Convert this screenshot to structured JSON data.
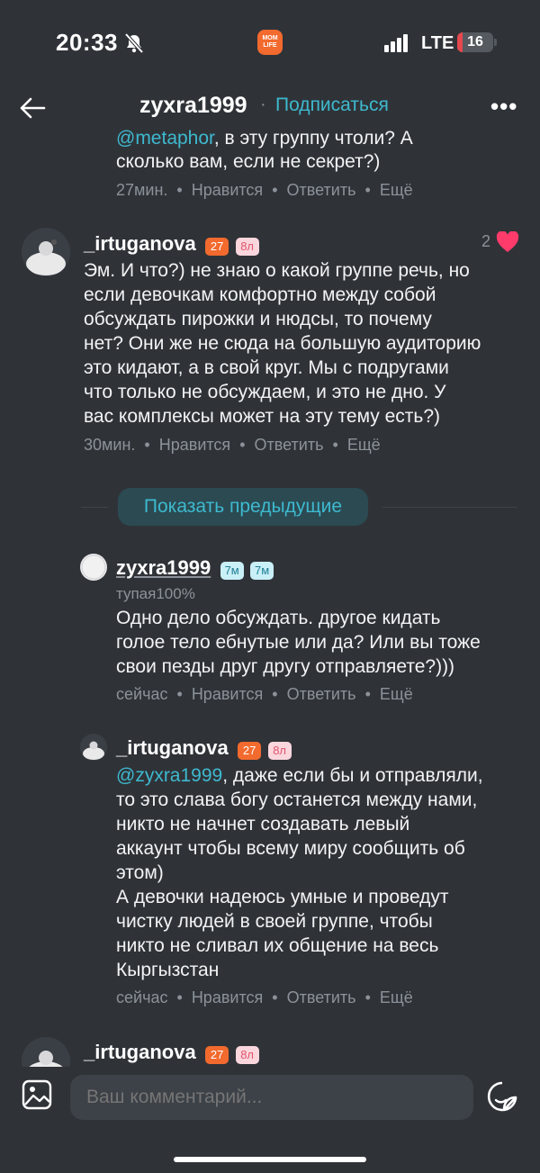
{
  "status": {
    "time": "20:33",
    "network": "LTE",
    "battery": "16",
    "app_badge": "MOM LIFE"
  },
  "header": {
    "username": "zyxra1999",
    "separator": "·",
    "subscribe": "Подписаться",
    "more": "•••"
  },
  "top_comment": {
    "mention": "@metaphor",
    "text_line1_rest": ", в эту группу чтоли? А",
    "text_line2": "сколько вам, если не секрет?)",
    "time": "27мин.",
    "like": "Нравится",
    "reply": "Ответить",
    "more": "Ещё",
    "dot": "•"
  },
  "comment_irtuganova_1": {
    "username": "_irtuganova",
    "badge_age": "27",
    "badge_child": "8л",
    "likes": "2",
    "text": "Эм. И что?) не знаю о какой группе речь, но\nесли девочкам комфортно между собой\nобсуждать пирожки и нюдсы, то почему\nнет? Они же не сюда на большую аудиторию\nэто кидают, а в свой круг. Мы с подругами\nчто только не обсуждаем, и это не дно. У\nвас комплексы может на эту тему есть?)",
    "time": "30мин.",
    "like": "Нравится",
    "reply": "Ответить",
    "more": "Ещё"
  },
  "show_previous": "Показать предыдущие",
  "reply_zyxra": {
    "username": "zyxra1999",
    "badge1": "7м",
    "badge2": "7м",
    "subtitle": "тупая100%",
    "text": "Одно дело обсуждать. другое кидать\nголое тело ебнутые или да? Или вы тоже\nсвои пезды друг другу отправляете?)))",
    "time": "сейчас",
    "like": "Нравится",
    "reply": "Ответить",
    "more": "Ещё"
  },
  "reply_irtuganova": {
    "username": "_irtuganova",
    "badge_age": "27",
    "badge_child": "8л",
    "mention": "@zyxra1999",
    "text_line1_rest": ", даже если бы и отправляли,",
    "text_rest": "то это слава богу останется между нами,\nникто не начнет создавать левый\nаккаунт чтобы всему миру сообщить об\nэтом)\nА девочки надеюсь умные и проведут\nчистку людей в своей группе, чтобы\nникто не сливал их общение на весь\nКыргызстан",
    "time": "сейчас",
    "like": "Нравится",
    "reply": "Ответить",
    "more": "Ещё"
  },
  "comment_irtuganova_2": {
    "username": "_irtuganova",
    "badge_age": "27",
    "badge_child": "8л"
  },
  "input": {
    "placeholder": "Ваш комментарий..."
  },
  "colors": {
    "background": "#2f3338",
    "accent": "#3eb9cf",
    "heart": "#ff3b6b",
    "age_badge": "#f26a2e"
  }
}
